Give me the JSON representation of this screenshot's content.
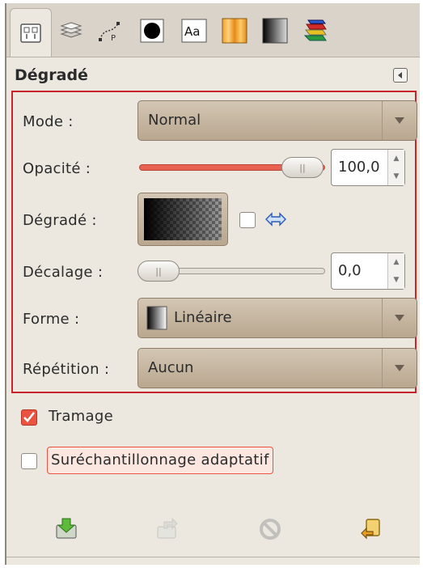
{
  "header": {
    "title": "Dégradé"
  },
  "options": {
    "mode": {
      "label": "Mode :",
      "value": "Normal"
    },
    "opacity": {
      "label": "Opacité :",
      "value": "100,0",
      "fraction": 1.0
    },
    "gradient": {
      "label": "Dégradé :"
    },
    "offset": {
      "label": "Décalage :",
      "value": "0,0",
      "fraction": 0.0
    },
    "shape": {
      "label": "Forme :",
      "value": "Linéaire"
    },
    "repeat": {
      "label": "Répétition :",
      "value": "Aucun"
    }
  },
  "dithering": {
    "label": "Tramage",
    "checked": true
  },
  "supersampling": {
    "label": "Suréchantillonnage adaptatif",
    "checked": false
  },
  "icons": {
    "tabs": [
      "tool-options-icon",
      "layers-icon",
      "paths-icon",
      "brush-icon",
      "font-icon",
      "pattern-icon",
      "gradient-icon",
      "palette-icon"
    ],
    "bottom": [
      "save-options-icon",
      "restore-options-icon",
      "delete-options-icon",
      "reset-options-icon"
    ]
  },
  "colors": {
    "highlight": "#c8232a",
    "slider_fill": "#e8604f",
    "accent_check": "#e9533f"
  }
}
